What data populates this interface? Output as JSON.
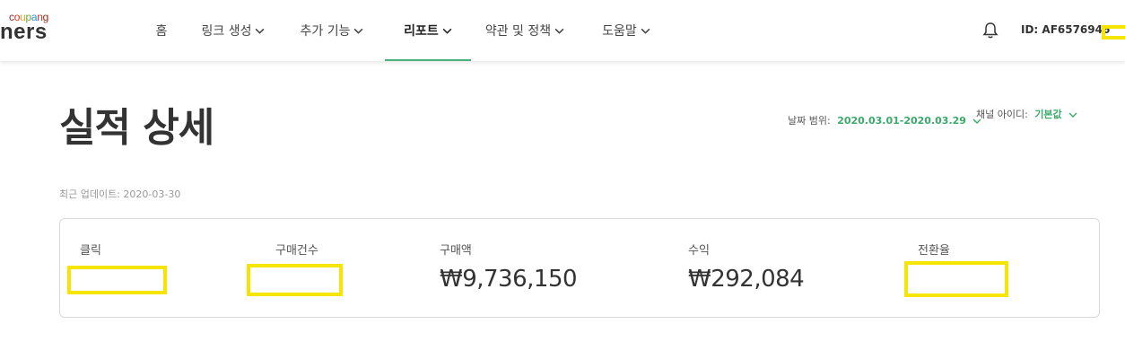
{
  "brand": {
    "logo_small_parts": [
      "c",
      "o",
      "u",
      "p",
      "a",
      "n",
      "g"
    ],
    "logo_small_colors": [
      "#8b2c1b",
      "#c8362a",
      "#e8a02f",
      "#6bab34",
      "#1f97d6",
      "#c8362a",
      "#8b2c1b"
    ],
    "logo_big": "ners"
  },
  "nav": {
    "items": [
      {
        "label": "홈"
      },
      {
        "label": "링크 생성"
      },
      {
        "label": "추가 기능"
      },
      {
        "label": "리포트"
      },
      {
        "label": "약관 및 정책"
      },
      {
        "label": "도움말"
      }
    ],
    "active_index": 3,
    "user_id": "ID: AF6576946"
  },
  "page": {
    "title": "실적 상세",
    "date_range_label": "날짜 범위:",
    "date_range_value": "2020.03.01-2020.03.29",
    "channel_label": "채널 아이디:",
    "channel_value": "기본값",
    "updated": "최근 업데이트: 2020-03-30"
  },
  "stats": [
    {
      "label": "클릭",
      "value": ""
    },
    {
      "label": "구매건수",
      "value": ""
    },
    {
      "label": "구매액",
      "value": "₩9,736,150"
    },
    {
      "label": "수익",
      "value": "₩292,084"
    },
    {
      "label": "전환율",
      "value": ""
    }
  ],
  "colors": {
    "accent": "#4bb07a",
    "highlight": "#f5e500"
  }
}
